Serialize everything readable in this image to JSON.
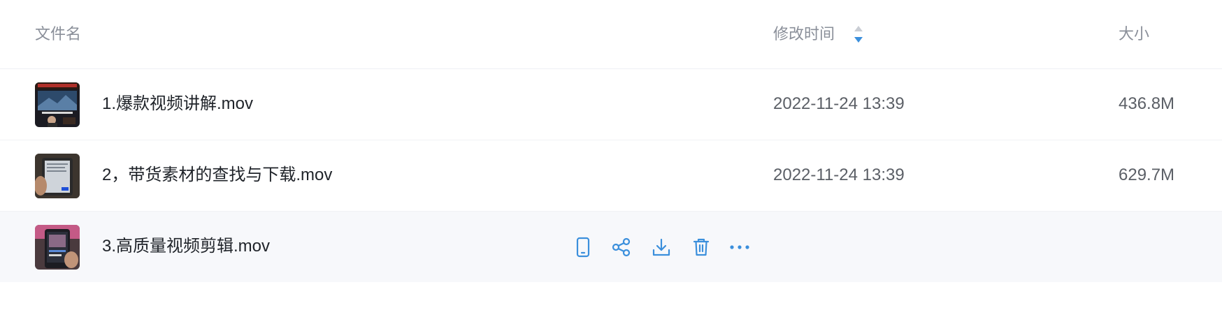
{
  "header": {
    "name_label": "文件名",
    "time_label": "修改时间",
    "size_label": "大小"
  },
  "files": [
    {
      "name": "1.爆款视频讲解.mov",
      "modified": "2022-11-24 13:39",
      "size": "436.8M"
    },
    {
      "name": "2，带货素材的查找与下载.mov",
      "modified": "2022-11-24 13:39",
      "size": "629.7M"
    },
    {
      "name": "3.高质量视频剪辑.mov",
      "modified": "",
      "size": ""
    }
  ],
  "row_actions": {
    "icons": [
      "phone-icon",
      "share-icon",
      "download-icon",
      "delete-icon",
      "more-icon"
    ]
  },
  "colors": {
    "accent": "#3b8fdc",
    "header_text": "#8a8f99",
    "primary_text": "#1f2329",
    "secondary_text": "#5b5f66",
    "hover_row_bg": "#f7f8fb"
  }
}
